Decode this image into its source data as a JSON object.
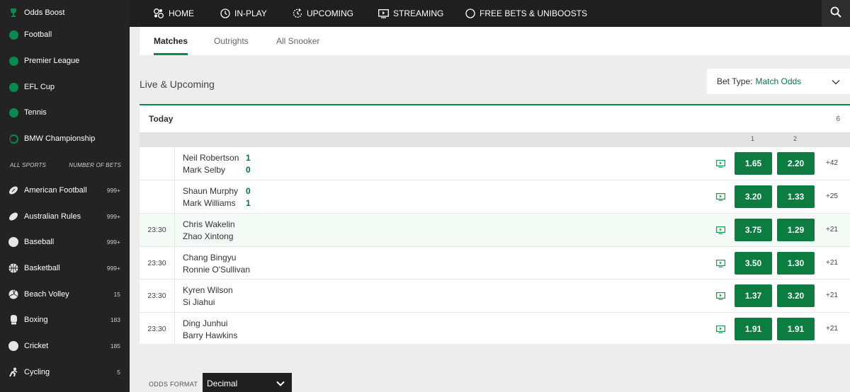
{
  "sidebar": {
    "top_items": [
      {
        "label": "Odds Boost",
        "icon": "trophy-icon"
      },
      {
        "label": "Football",
        "icon": "football-icon"
      },
      {
        "label": "Premier League",
        "icon": "football-icon"
      },
      {
        "label": "EFL Cup",
        "icon": "football-icon"
      },
      {
        "label": "Tennis",
        "icon": "tennis-ball-icon"
      },
      {
        "label": "BMW Championship",
        "icon": "golf-icon"
      }
    ],
    "header_left": "ALL SPORTS",
    "header_right": "NUMBER OF BETS",
    "sports": [
      {
        "label": "American Football",
        "count": "999+",
        "icon": "american-football-icon"
      },
      {
        "label": "Australian Rules",
        "count": "999+",
        "icon": "australian-rules-icon"
      },
      {
        "label": "Baseball",
        "count": "999+",
        "icon": "baseball-icon"
      },
      {
        "label": "Basketball",
        "count": "999+",
        "icon": "basketball-icon"
      },
      {
        "label": "Beach Volley",
        "count": "15",
        "icon": "volleyball-icon"
      },
      {
        "label": "Boxing",
        "count": "183",
        "icon": "boxing-glove-icon"
      },
      {
        "label": "Cricket",
        "count": "185",
        "icon": "cricket-ball-icon"
      },
      {
        "label": "Cycling",
        "count": "5",
        "icon": "cycling-icon"
      }
    ]
  },
  "nav": {
    "home": "HOME",
    "inplay": "IN-PLAY",
    "upcoming": "UPCOMING",
    "streaming": "STREAMING",
    "freebets": "FREE BETS & UNIBOOSTS"
  },
  "tabs": {
    "matches": "Matches",
    "outrights": "Outrights",
    "all_snooker": "All Snooker"
  },
  "section_title": "Live & Upcoming",
  "bet_type": {
    "label": "Bet Type:",
    "value": "Match Odds"
  },
  "group": {
    "title": "Today",
    "count": "6"
  },
  "columns": {
    "c1": "1",
    "c2": "2"
  },
  "matches": [
    {
      "time": "",
      "player1": "Neil Robertson",
      "player2": "Mark Selby",
      "score1": "1",
      "score2": "0",
      "odd1": "1.65",
      "odd2": "2.20",
      "more": "+42"
    },
    {
      "time": "",
      "player1": "Shaun Murphy",
      "player2": "Mark Williams",
      "score1": "0",
      "score2": "1",
      "odd1": "3.20",
      "odd2": "1.33",
      "more": "+25"
    },
    {
      "time": "23:30",
      "player1": "Chris Wakelin",
      "player2": "Zhao Xintong",
      "score1": "",
      "score2": "",
      "odd1": "3.75",
      "odd2": "1.29",
      "more": "+21"
    },
    {
      "time": "23:30",
      "player1": "Chang Bingyu",
      "player2": "Ronnie O'Sullivan",
      "score1": "",
      "score2": "",
      "odd1": "3.50",
      "odd2": "1.30",
      "more": "+21"
    },
    {
      "time": "23:30",
      "player1": "Kyren Wilson",
      "player2": "Si Jiahui",
      "score1": "",
      "score2": "",
      "odd1": "1.37",
      "odd2": "3.20",
      "more": "+21"
    },
    {
      "time": "23:30",
      "player1": "Ding Junhui",
      "player2": "Barry Hawkins",
      "score1": "",
      "score2": "",
      "odd1": "1.91",
      "odd2": "1.91",
      "more": "+21"
    }
  ],
  "odds_format": {
    "label": "ODDS FORMAT",
    "value": "Decimal"
  },
  "colors": {
    "accent": "#0b8a4f",
    "odds_button": "#0d7c41",
    "nav_bg": "#1f1f1f",
    "sidebar_bg": "#232323"
  }
}
